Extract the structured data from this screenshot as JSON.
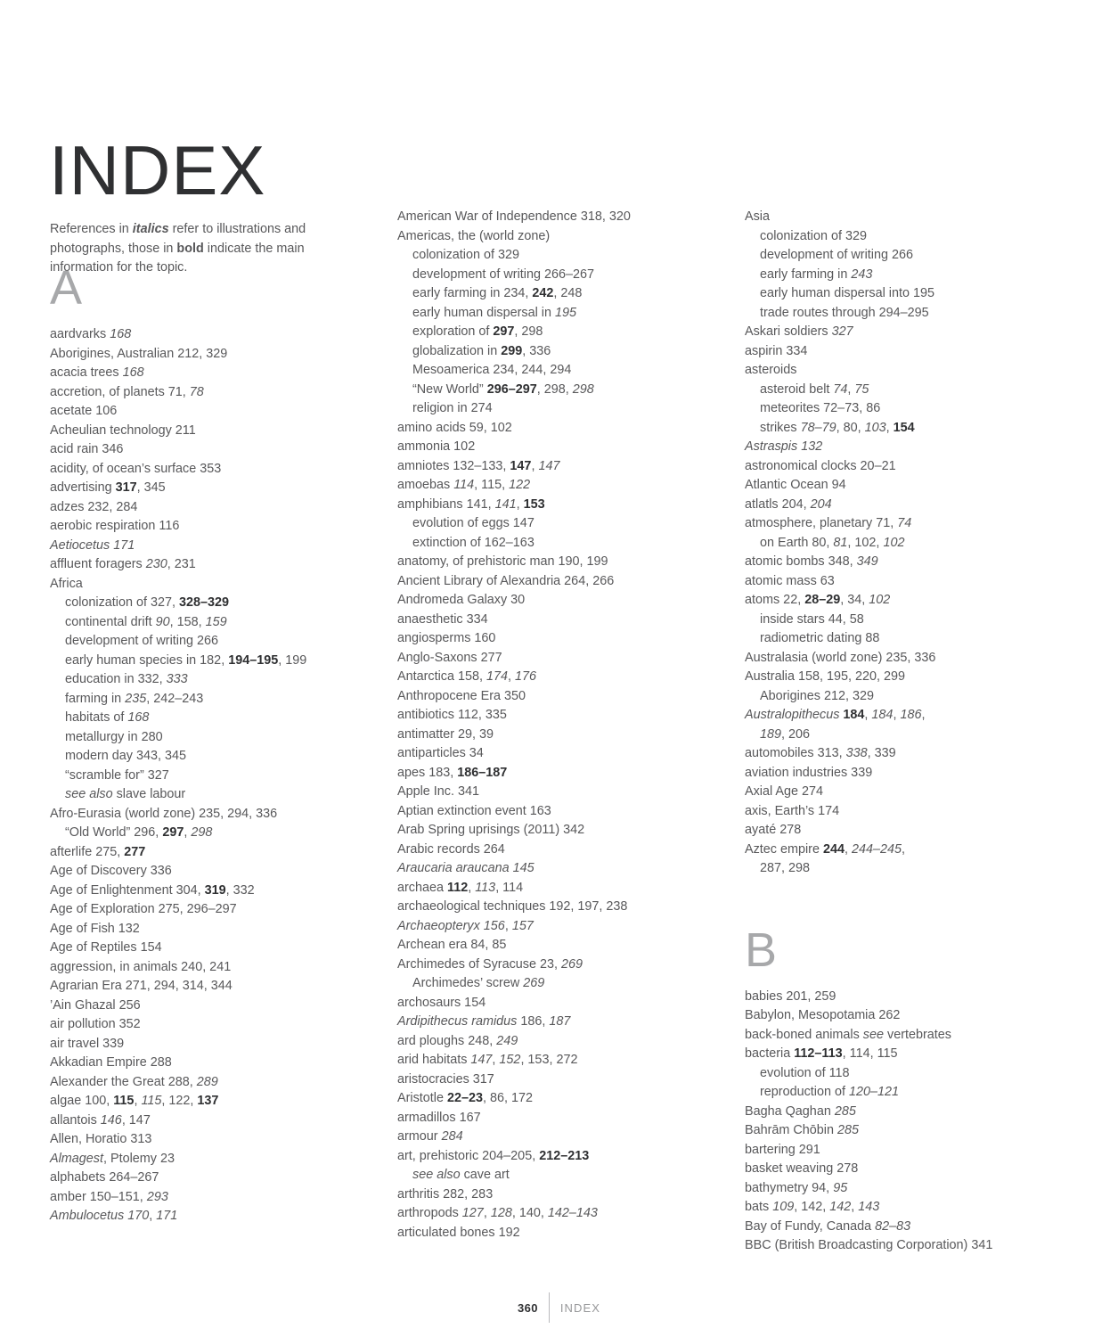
{
  "page": {
    "title": "INDEX",
    "intro": {
      "part1": "References in ",
      "italic_word": "italics",
      "part2": " refer to illustrations and photographs, those in ",
      "bold_word": "bold",
      "part3": " indicate the main information for the topic."
    },
    "footer": {
      "folio": "360",
      "label": "INDEX"
    },
    "colors": {
      "body_text": "#58585a",
      "emphasis_text": "#2f3032",
      "letter_heading": "#a7a8aa",
      "rule": "#b9babc",
      "background": "#ffffff"
    }
  },
  "columns": [
    {
      "id": "column-1",
      "letter_heading": "A",
      "entries": [
        {
          "level": 1,
          "html": "aardvarks <i>168</i>"
        },
        {
          "level": 1,
          "html": "Aborigines, Australian 212, 329"
        },
        {
          "level": 1,
          "html": "acacia trees <i>168</i>"
        },
        {
          "level": 1,
          "html": "accretion, of planets 71, <i>78</i>"
        },
        {
          "level": 1,
          "html": "acetate 106"
        },
        {
          "level": 1,
          "html": "Acheulian technology 211"
        },
        {
          "level": 1,
          "html": "acid rain 346"
        },
        {
          "level": 1,
          "html": "acidity, of ocean’s surface 353"
        },
        {
          "level": 1,
          "html": "advertising <b>317</b>, 345"
        },
        {
          "level": 1,
          "html": "adzes 232, 284"
        },
        {
          "level": 1,
          "html": "aerobic respiration 116"
        },
        {
          "level": 1,
          "html": "<i>Aetiocetus</i> <i>171</i>"
        },
        {
          "level": 1,
          "html": "affluent foragers <i>230</i>, 231"
        },
        {
          "level": 1,
          "html": "Africa"
        },
        {
          "level": 2,
          "html": "colonization of 327, <b>328–329</b>"
        },
        {
          "level": 2,
          "html": "continental drift <i>90</i>, 158, <i>159</i>"
        },
        {
          "level": 2,
          "html": "development of writing 266"
        },
        {
          "level": 2,
          "html": "early human species in 182, <b>194–195</b>, 199"
        },
        {
          "level": 2,
          "html": "education in 332, <i>333</i>"
        },
        {
          "level": 2,
          "html": "farming in <i>235</i>, 242–243"
        },
        {
          "level": 2,
          "html": "habitats of <i>168</i>"
        },
        {
          "level": 2,
          "html": "metallurgy in 280"
        },
        {
          "level": 2,
          "html": "modern day 343, 345"
        },
        {
          "level": 2,
          "html": "“scramble for” 327"
        },
        {
          "level": 2,
          "html": "<i>see also</i> slave labour"
        },
        {
          "level": 1,
          "html": "Afro-Eurasia (world zone) 235, 294, 336"
        },
        {
          "level": 2,
          "html": "“Old World” 296, <b>297</b>, <i>298</i>"
        },
        {
          "level": 1,
          "html": "afterlife 275, <b>277</b>"
        },
        {
          "level": 1,
          "html": "Age of Discovery 336"
        },
        {
          "level": 1,
          "html": "Age of Enlightenment 304, <b>319</b>, 332"
        },
        {
          "level": 1,
          "html": "Age of Exploration 275, 296–297"
        },
        {
          "level": 1,
          "html": "Age of Fish 132"
        },
        {
          "level": 1,
          "html": "Age of Reptiles 154"
        },
        {
          "level": 1,
          "html": "aggression, in animals 240, 241"
        },
        {
          "level": 1,
          "html": "Agrarian Era 271, 294, 314, 344"
        },
        {
          "level": 1,
          "html": "’Ain Ghazal 256"
        },
        {
          "level": 1,
          "html": "air pollution 352"
        },
        {
          "level": 1,
          "html": "air travel 339"
        },
        {
          "level": 1,
          "html": "Akkadian Empire 288"
        },
        {
          "level": 1,
          "html": "Alexander the Great 288, <i>289</i>"
        },
        {
          "level": 1,
          "html": "algae 100, <b>115</b>, <i>115</i>, 122, <b>137</b>"
        },
        {
          "level": 1,
          "html": "allantois <i>146</i>, 147"
        },
        {
          "level": 1,
          "html": "Allen, Horatio 313"
        },
        {
          "level": 1,
          "html": "<i>Almagest</i>, Ptolemy 23"
        },
        {
          "level": 1,
          "html": "alphabets 264–267"
        },
        {
          "level": 1,
          "html": "amber 150–151, <i>293</i>"
        },
        {
          "level": 1,
          "html": "<i>Ambulocetus</i> <i>170</i>, <i>171</i>"
        }
      ]
    },
    {
      "id": "column-2",
      "letter_heading": "",
      "entries": [
        {
          "level": 1,
          "html": "American War of Independence 318, 320"
        },
        {
          "level": 1,
          "html": "Americas, the (world zone)"
        },
        {
          "level": 2,
          "html": "colonization of 329"
        },
        {
          "level": 2,
          "html": "development of writing 266–267"
        },
        {
          "level": 2,
          "html": "early farming in 234, <b>242</b>, 248"
        },
        {
          "level": 2,
          "html": "early human dispersal in <i>195</i>"
        },
        {
          "level": 2,
          "html": "exploration of <b>297</b>, 298"
        },
        {
          "level": 2,
          "html": "globalization in <b>299</b>, 336"
        },
        {
          "level": 2,
          "html": "Mesoamerica 234, 244, 294"
        },
        {
          "level": 2,
          "html": "“New World” <b>296–297</b>, 298, <i>298</i>"
        },
        {
          "level": 2,
          "html": "religion in 274"
        },
        {
          "level": 1,
          "html": "amino acids 59, 102"
        },
        {
          "level": 1,
          "html": "ammonia 102"
        },
        {
          "level": 1,
          "html": "amniotes 132–133, <b>147</b>, <i>147</i>"
        },
        {
          "level": 1,
          "html": "amoebas <i>114</i>, 115, <i>122</i>"
        },
        {
          "level": 1,
          "html": "amphibians 141, <i>141</i>, <b>153</b>"
        },
        {
          "level": 2,
          "html": "evolution of eggs 147"
        },
        {
          "level": 2,
          "html": "extinction of 162–163"
        },
        {
          "level": 1,
          "html": "anatomy, of prehistoric man 190, 199"
        },
        {
          "level": 1,
          "html": "Ancient Library of Alexandria 264, 266"
        },
        {
          "level": 1,
          "html": "Andromeda Galaxy 30"
        },
        {
          "level": 1,
          "html": "anaesthetic 334"
        },
        {
          "level": 1,
          "html": "angiosperms 160"
        },
        {
          "level": 1,
          "html": "Anglo-Saxons 277"
        },
        {
          "level": 1,
          "html": "Antarctica 158, <i>174</i>, <i>176</i>"
        },
        {
          "level": 1,
          "html": "Anthropocene Era 350"
        },
        {
          "level": 1,
          "html": "antibiotics 112, 335"
        },
        {
          "level": 1,
          "html": "antimatter 29, 39"
        },
        {
          "level": 1,
          "html": "antiparticles 34"
        },
        {
          "level": 1,
          "html": "apes 183, <b>186–187</b>"
        },
        {
          "level": 1,
          "html": "Apple Inc. 341"
        },
        {
          "level": 1,
          "html": "Aptian extinction event 163"
        },
        {
          "level": 1,
          "html": "Arab Spring uprisings (2011) 342"
        },
        {
          "level": 1,
          "html": "Arabic records 264"
        },
        {
          "level": 1,
          "html": "<i>Araucaria araucana</i> <i>145</i>"
        },
        {
          "level": 1,
          "html": "archaea <b>112</b>, <i>113</i>, 114"
        },
        {
          "level": 1,
          "html": "archaeological techniques 192, 197, 238"
        },
        {
          "level": 1,
          "html": "<i>Archaeopteryx</i> <i>156</i>, <i>157</i>"
        },
        {
          "level": 1,
          "html": "Archean era 84, 85"
        },
        {
          "level": 1,
          "html": "Archimedes of Syracuse 23, <i>269</i>"
        },
        {
          "level": 2,
          "html": "Archimedes’ screw <i>269</i>"
        },
        {
          "level": 1,
          "html": "archosaurs 154"
        },
        {
          "level": 1,
          "html": "<i>Ardipithecus ramidus</i> 186, <i>187</i>"
        },
        {
          "level": 1,
          "html": "ard ploughs 248, <i>249</i>"
        },
        {
          "level": 1,
          "html": "arid habitats <i>147</i>, <i>152</i>, 153, 272"
        },
        {
          "level": 1,
          "html": "aristocracies 317"
        },
        {
          "level": 1,
          "html": "Aristotle <b>22–23</b>, 86, 172"
        },
        {
          "level": 1,
          "html": "armadillos 167"
        },
        {
          "level": 1,
          "html": "armour <i>284</i>"
        },
        {
          "level": 1,
          "html": "art, prehistoric 204–205, <b>212–213</b>"
        },
        {
          "level": 2,
          "html": "<i>see also</i> cave art"
        },
        {
          "level": 1,
          "html": "arthritis 282, 283"
        },
        {
          "level": 1,
          "html": "arthropods <i>127</i>, <i>128</i>, 140, <i>142–143</i>"
        },
        {
          "level": 1,
          "html": "articulated bones 192"
        }
      ]
    },
    {
      "id": "column-3",
      "letter_heading": "B",
      "entries": [
        {
          "level": 1,
          "html": "Asia"
        },
        {
          "level": 2,
          "html": "colonization of 329"
        },
        {
          "level": 2,
          "html": "development of writing 266"
        },
        {
          "level": 2,
          "html": "early farming in <i>243</i>"
        },
        {
          "level": 2,
          "html": "early human dispersal into 195"
        },
        {
          "level": 2,
          "html": "trade routes through 294–295"
        },
        {
          "level": 1,
          "html": "Askari soldiers <i>327</i>"
        },
        {
          "level": 1,
          "html": "aspirin 334"
        },
        {
          "level": 1,
          "html": "asteroids"
        },
        {
          "level": 2,
          "html": "asteroid belt <i>74</i>, <i>75</i>"
        },
        {
          "level": 2,
          "html": "meteorites 72–73, 86"
        },
        {
          "level": 2,
          "html": "strikes <i>78–79</i>, 80, <i>103</i>, <b>154</b>"
        },
        {
          "level": 1,
          "html": "<i>Astraspis</i> <i>132</i>"
        },
        {
          "level": 1,
          "html": "astronomical clocks 20–21"
        },
        {
          "level": 1,
          "html": "Atlantic Ocean 94"
        },
        {
          "level": 1,
          "html": "atlatls 204, <i>204</i>"
        },
        {
          "level": 1,
          "html": "atmosphere, planetary 71, <i>74</i>"
        },
        {
          "level": 2,
          "html": "on Earth 80, <i>81</i>, 102, <i>102</i>"
        },
        {
          "level": 1,
          "html": "atomic bombs 348, <i>349</i>"
        },
        {
          "level": 1,
          "html": "atomic mass 63"
        },
        {
          "level": 1,
          "html": "atoms 22, <b>28–29</b>, 34, <i>102</i>"
        },
        {
          "level": 2,
          "html": "inside stars 44, 58"
        },
        {
          "level": 2,
          "html": "radiometric dating 88"
        },
        {
          "level": 1,
          "html": "Australasia (world zone) 235, 336"
        },
        {
          "level": 1,
          "html": "Australia 158, 195, 220, 299"
        },
        {
          "level": 2,
          "html": "Aborigines 212, 329"
        },
        {
          "level": 1,
          "html": "<i>Australopithecus</i> <b>184</b>, <i>184</i>, <i>186</i>,"
        },
        {
          "level": 2,
          "html": "<i>189</i>, 206"
        },
        {
          "level": 1,
          "html": "automobiles 313, <i>338</i>, 339"
        },
        {
          "level": 1,
          "html": "aviation industries 339"
        },
        {
          "level": 1,
          "html": "Axial Age 274"
        },
        {
          "level": 1,
          "html": "axis, Earth’s 174"
        },
        {
          "level": 1,
          "html": "ayaté 278"
        },
        {
          "level": 1,
          "html": "Aztec empire <b>244</b>, <i>244–245</i>,"
        },
        {
          "level": 2,
          "html": "287, 298"
        }
      ],
      "entries_after_letter": [
        {
          "level": 1,
          "html": "babies 201, 259"
        },
        {
          "level": 1,
          "html": "Babylon, Mesopotamia 262"
        },
        {
          "level": 1,
          "html": "back-boned animals <i>see</i> vertebrates"
        },
        {
          "level": 1,
          "html": "bacteria <b>112–113</b>, 114, 115"
        },
        {
          "level": 2,
          "html": "evolution of 118"
        },
        {
          "level": 2,
          "html": "reproduction of <i>120–121</i>"
        },
        {
          "level": 1,
          "html": "Bagha Qaghan <i>285</i>"
        },
        {
          "level": 1,
          "html": "Bahrām Chōbin <i>285</i>"
        },
        {
          "level": 1,
          "html": "bartering 291"
        },
        {
          "level": 1,
          "html": "basket weaving 278"
        },
        {
          "level": 1,
          "html": "bathymetry 94, <i>95</i>"
        },
        {
          "level": 1,
          "html": "bats <i>109</i>, 142, <i>142</i>, <i>143</i>"
        },
        {
          "level": 1,
          "html": "Bay of Fundy, Canada <i>82–83</i>"
        },
        {
          "level": 1,
          "html": "BBC (British Broadcasting Corporation) 341"
        }
      ]
    }
  ]
}
